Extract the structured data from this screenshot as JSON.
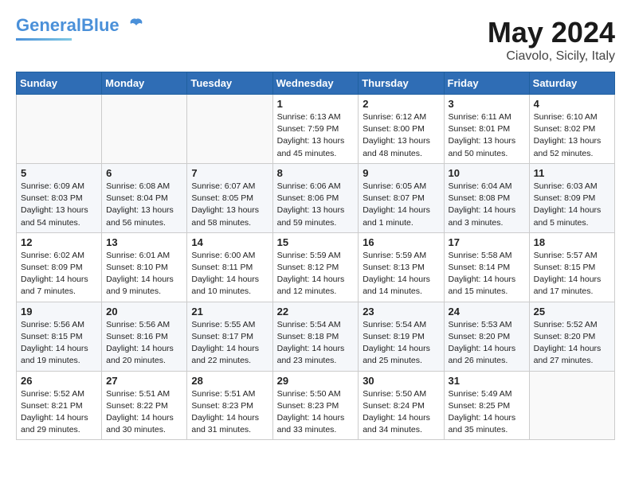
{
  "header": {
    "logo_line1": "General",
    "logo_line2": "Blue",
    "month": "May 2024",
    "location": "Ciavolo, Sicily, Italy"
  },
  "days_of_week": [
    "Sunday",
    "Monday",
    "Tuesday",
    "Wednesday",
    "Thursday",
    "Friday",
    "Saturday"
  ],
  "weeks": [
    [
      {
        "day": "",
        "content": ""
      },
      {
        "day": "",
        "content": ""
      },
      {
        "day": "",
        "content": ""
      },
      {
        "day": "1",
        "content": "Sunrise: 6:13 AM\nSunset: 7:59 PM\nDaylight: 13 hours\nand 45 minutes."
      },
      {
        "day": "2",
        "content": "Sunrise: 6:12 AM\nSunset: 8:00 PM\nDaylight: 13 hours\nand 48 minutes."
      },
      {
        "day": "3",
        "content": "Sunrise: 6:11 AM\nSunset: 8:01 PM\nDaylight: 13 hours\nand 50 minutes."
      },
      {
        "day": "4",
        "content": "Sunrise: 6:10 AM\nSunset: 8:02 PM\nDaylight: 13 hours\nand 52 minutes."
      }
    ],
    [
      {
        "day": "5",
        "content": "Sunrise: 6:09 AM\nSunset: 8:03 PM\nDaylight: 13 hours\nand 54 minutes."
      },
      {
        "day": "6",
        "content": "Sunrise: 6:08 AM\nSunset: 8:04 PM\nDaylight: 13 hours\nand 56 minutes."
      },
      {
        "day": "7",
        "content": "Sunrise: 6:07 AM\nSunset: 8:05 PM\nDaylight: 13 hours\nand 58 minutes."
      },
      {
        "day": "8",
        "content": "Sunrise: 6:06 AM\nSunset: 8:06 PM\nDaylight: 13 hours\nand 59 minutes."
      },
      {
        "day": "9",
        "content": "Sunrise: 6:05 AM\nSunset: 8:07 PM\nDaylight: 14 hours\nand 1 minute."
      },
      {
        "day": "10",
        "content": "Sunrise: 6:04 AM\nSunset: 8:08 PM\nDaylight: 14 hours\nand 3 minutes."
      },
      {
        "day": "11",
        "content": "Sunrise: 6:03 AM\nSunset: 8:09 PM\nDaylight: 14 hours\nand 5 minutes."
      }
    ],
    [
      {
        "day": "12",
        "content": "Sunrise: 6:02 AM\nSunset: 8:09 PM\nDaylight: 14 hours\nand 7 minutes."
      },
      {
        "day": "13",
        "content": "Sunrise: 6:01 AM\nSunset: 8:10 PM\nDaylight: 14 hours\nand 9 minutes."
      },
      {
        "day": "14",
        "content": "Sunrise: 6:00 AM\nSunset: 8:11 PM\nDaylight: 14 hours\nand 10 minutes."
      },
      {
        "day": "15",
        "content": "Sunrise: 5:59 AM\nSunset: 8:12 PM\nDaylight: 14 hours\nand 12 minutes."
      },
      {
        "day": "16",
        "content": "Sunrise: 5:59 AM\nSunset: 8:13 PM\nDaylight: 14 hours\nand 14 minutes."
      },
      {
        "day": "17",
        "content": "Sunrise: 5:58 AM\nSunset: 8:14 PM\nDaylight: 14 hours\nand 15 minutes."
      },
      {
        "day": "18",
        "content": "Sunrise: 5:57 AM\nSunset: 8:15 PM\nDaylight: 14 hours\nand 17 minutes."
      }
    ],
    [
      {
        "day": "19",
        "content": "Sunrise: 5:56 AM\nSunset: 8:15 PM\nDaylight: 14 hours\nand 19 minutes."
      },
      {
        "day": "20",
        "content": "Sunrise: 5:56 AM\nSunset: 8:16 PM\nDaylight: 14 hours\nand 20 minutes."
      },
      {
        "day": "21",
        "content": "Sunrise: 5:55 AM\nSunset: 8:17 PM\nDaylight: 14 hours\nand 22 minutes."
      },
      {
        "day": "22",
        "content": "Sunrise: 5:54 AM\nSunset: 8:18 PM\nDaylight: 14 hours\nand 23 minutes."
      },
      {
        "day": "23",
        "content": "Sunrise: 5:54 AM\nSunset: 8:19 PM\nDaylight: 14 hours\nand 25 minutes."
      },
      {
        "day": "24",
        "content": "Sunrise: 5:53 AM\nSunset: 8:20 PM\nDaylight: 14 hours\nand 26 minutes."
      },
      {
        "day": "25",
        "content": "Sunrise: 5:52 AM\nSunset: 8:20 PM\nDaylight: 14 hours\nand 27 minutes."
      }
    ],
    [
      {
        "day": "26",
        "content": "Sunrise: 5:52 AM\nSunset: 8:21 PM\nDaylight: 14 hours\nand 29 minutes."
      },
      {
        "day": "27",
        "content": "Sunrise: 5:51 AM\nSunset: 8:22 PM\nDaylight: 14 hours\nand 30 minutes."
      },
      {
        "day": "28",
        "content": "Sunrise: 5:51 AM\nSunset: 8:23 PM\nDaylight: 14 hours\nand 31 minutes."
      },
      {
        "day": "29",
        "content": "Sunrise: 5:50 AM\nSunset: 8:23 PM\nDaylight: 14 hours\nand 33 minutes."
      },
      {
        "day": "30",
        "content": "Sunrise: 5:50 AM\nSunset: 8:24 PM\nDaylight: 14 hours\nand 34 minutes."
      },
      {
        "day": "31",
        "content": "Sunrise: 5:49 AM\nSunset: 8:25 PM\nDaylight: 14 hours\nand 35 minutes."
      },
      {
        "day": "",
        "content": ""
      }
    ]
  ]
}
